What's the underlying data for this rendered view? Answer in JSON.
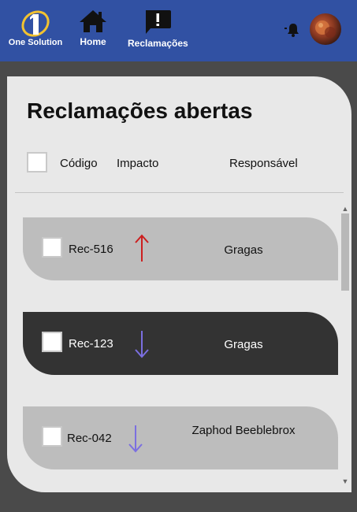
{
  "header": {
    "logo_text": "One Solution",
    "nav": [
      {
        "label": "Home",
        "icon": "home-icon"
      },
      {
        "label": "Reclamações",
        "icon": "complaint-icon"
      }
    ],
    "notification_icon": "bell-icon",
    "avatar": "user-avatar"
  },
  "main": {
    "title": "Reclamações abertas",
    "columns": {
      "code": "Código",
      "impact": "Impacto",
      "responsible": "Responsável"
    },
    "rows": [
      {
        "code": "Rec-516",
        "impact": "up",
        "impact_icon": "arrow-up-icon",
        "impact_color": "#cc1f1f",
        "responsible": "Gragas",
        "style": "light"
      },
      {
        "code": "Rec-123",
        "impact": "down",
        "impact_icon": "arrow-down-icon",
        "impact_color": "#7b6fe0",
        "responsible": "Gragas",
        "style": "dark"
      },
      {
        "code": "Rec-042",
        "impact": "down",
        "impact_icon": "arrow-down-icon",
        "impact_color": "#7b6fe0",
        "responsible": "Zaphod Beeblebrox",
        "style": "light"
      }
    ]
  },
  "colors": {
    "header_bg": "#3151a3",
    "page_bg": "#4a4a4a",
    "panel_bg": "#e8e8e8",
    "row_light": "#bdbdbd",
    "row_dark": "#333333"
  }
}
